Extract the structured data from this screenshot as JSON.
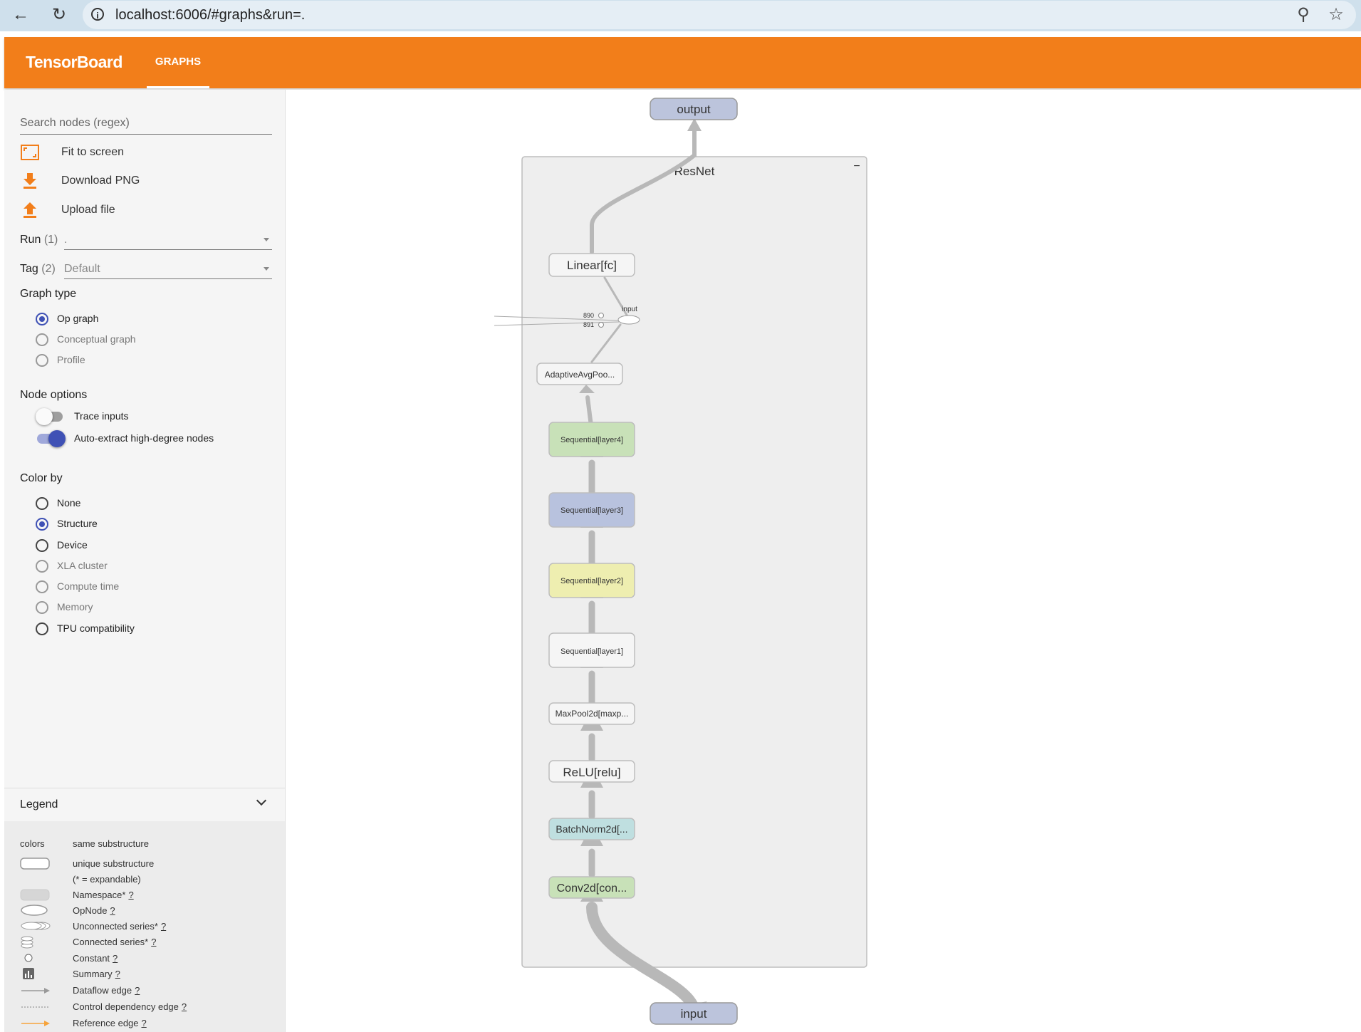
{
  "browser": {
    "url": "localhost:6006/#graphs&run=."
  },
  "header": {
    "title": "TensorBoard",
    "tab": "GRAPHS"
  },
  "sidebar": {
    "search_placeholder": "Search nodes (regex)",
    "actions": {
      "fit": "Fit to screen",
      "download": "Download PNG",
      "upload": "Upload file"
    },
    "run": {
      "label": "Run",
      "count": "(1)",
      "value": "."
    },
    "tag": {
      "label": "Tag",
      "count": "(2)",
      "value": "Default"
    },
    "graph_type": {
      "title": "Graph type",
      "options": [
        "Op graph",
        "Conceptual graph",
        "Profile"
      ],
      "selected": "Op graph"
    },
    "node_options": {
      "title": "Node options",
      "trace_inputs": {
        "label": "Trace inputs",
        "on": false
      },
      "auto_extract": {
        "label": "Auto-extract high-degree nodes",
        "on": true
      }
    },
    "color_by": {
      "title": "Color by",
      "options": [
        "None",
        "Structure",
        "Device",
        "XLA cluster",
        "Compute time",
        "Memory",
        "TPU compatibility"
      ],
      "selected": "Structure"
    },
    "legend": {
      "title": "Legend",
      "colors_key": "colors",
      "same_substructure": "same substructure",
      "unique_substructure": "unique substructure",
      "expandable_note": "(* = expandable)",
      "items": [
        "Namespace*",
        "OpNode",
        "Unconnected series*",
        "Connected series*",
        "Constant",
        "Summary",
        "Dataflow edge",
        "Control dependency edge",
        "Reference edge"
      ],
      "help": "?"
    }
  },
  "graph": {
    "container_label": "ResNet",
    "collapse_symbol": "−",
    "output_label": "output",
    "input_label": "input",
    "inner_input_label": "input",
    "constants": [
      "890",
      "891"
    ],
    "nodes": [
      {
        "label": "Linear[fc]",
        "fill": "#f5f5f5"
      },
      {
        "label": "AdaptiveAvgPoo...",
        "fill": "#f5f5f5"
      },
      {
        "label": "Sequential[layer4]",
        "fill": "#c8e1b8"
      },
      {
        "label": "Sequential[layer3]",
        "fill": "#b8c2de"
      },
      {
        "label": "Sequential[layer2]",
        "fill": "#eeeeb0"
      },
      {
        "label": "Sequential[layer1]",
        "fill": "#f5f5f5"
      },
      {
        "label": "MaxPool2d[maxp...",
        "fill": "#f5f5f5"
      },
      {
        "label": "ReLU[relu]",
        "fill": "#f5f5f5"
      },
      {
        "label": "BatchNorm2d[...",
        "fill": "#bfdfe0"
      },
      {
        "label": "Conv2d[con...",
        "fill": "#c8e1b8"
      }
    ],
    "colors": {
      "io_fill": "#bcc4dc",
      "container_fill": "#eeeeee",
      "edge": "#b8b8b8"
    }
  }
}
